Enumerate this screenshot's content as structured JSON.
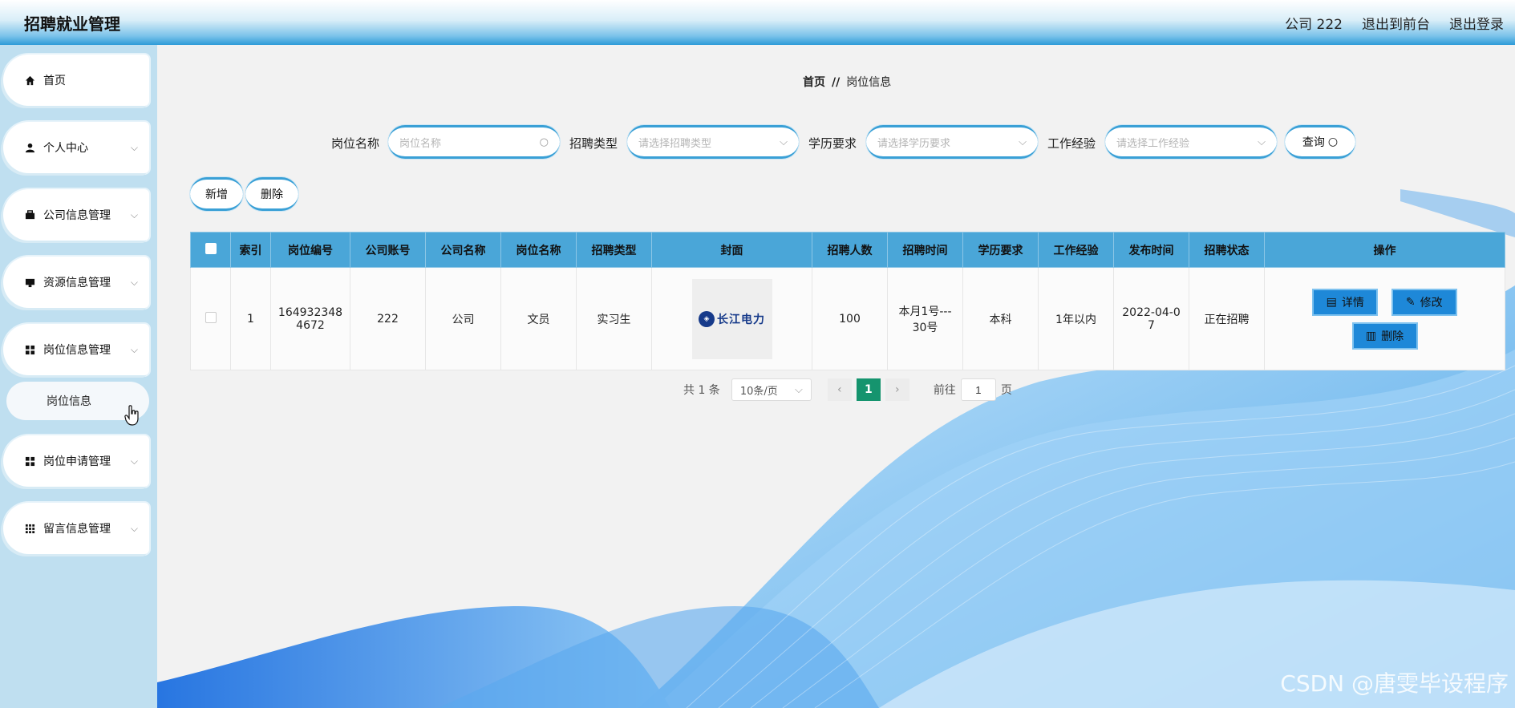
{
  "app": {
    "title": "招聘就业管理"
  },
  "topnav": {
    "user": "公司 222",
    "to_front": "退出到前台",
    "logout": "退出登录"
  },
  "sidebar": {
    "items": [
      {
        "label": "首页",
        "icon": "home-icon"
      },
      {
        "label": "个人中心",
        "icon": "user-icon"
      },
      {
        "label": "公司信息管理",
        "icon": "briefcase-icon"
      },
      {
        "label": "资源信息管理",
        "icon": "monitor-icon"
      },
      {
        "label": "岗位信息管理",
        "icon": "grid-icon"
      },
      {
        "label": "岗位申请管理",
        "icon": "grid-icon"
      },
      {
        "label": "留言信息管理",
        "icon": "apps-icon"
      }
    ],
    "sub_item": "岗位信息"
  },
  "breadcrumb": {
    "home": "首页",
    "sep": "//",
    "current": "岗位信息"
  },
  "search": {
    "job_label": "岗位名称",
    "job_placeholder": "岗位名称",
    "type_label": "招聘类型",
    "type_placeholder": "请选择招聘类型",
    "edu_label": "学历要求",
    "edu_placeholder": "请选择学历要求",
    "exp_label": "工作经验",
    "exp_placeholder": "请选择工作经验",
    "query": "查询"
  },
  "actions": {
    "add": "新增",
    "delete": "删除"
  },
  "table": {
    "headers": [
      "索引",
      "岗位编号",
      "公司账号",
      "公司名称",
      "岗位名称",
      "招聘类型",
      "封面",
      "招聘人数",
      "招聘时间",
      "学历要求",
      "工作经验",
      "发布时间",
      "招聘状态",
      "操作"
    ],
    "rows": [
      {
        "index": "1",
        "job_no_1": "164932348",
        "job_no_2": "4672",
        "company_account": "222",
        "company_name": "公司",
        "job_name": "文员",
        "type": "实习生",
        "cover_text": "长江电力",
        "count": "100",
        "time_1": "本月1号---",
        "time_2": "30号",
        "education": "本科",
        "experience": "1年以内",
        "publish_1": "2022-04-0",
        "publish_2": "7",
        "status": "正在招聘"
      }
    ],
    "op_detail": "详情",
    "op_edit": "修改",
    "op_delete": "删除"
  },
  "pager": {
    "total": "共 1 条",
    "size": "10条/页",
    "current": "1",
    "goto": "前往",
    "goto_value": "1",
    "page_unit": "页"
  },
  "watermark": "CSDN @唐雯毕设程序",
  "colors": {
    "accent": "#4aa6d8",
    "button": "#1e88d8",
    "pager_current": "#15946e",
    "sidebar_bg": "#bfdff0"
  }
}
